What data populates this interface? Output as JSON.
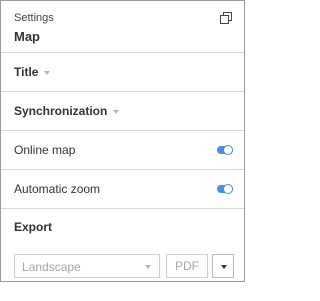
{
  "header": {
    "caption": "Settings",
    "title": "Map",
    "restore_icon": "restore-window-icon"
  },
  "sections": {
    "title_label": "Title",
    "sync_label": "Synchronization"
  },
  "toggles": {
    "online_map": {
      "label": "Online map",
      "on": true
    },
    "automatic_zoom": {
      "label": "Automatic zoom",
      "on": true
    }
  },
  "export": {
    "label": "Export",
    "orientation_value": "Landscape",
    "format_label": "PDF"
  },
  "colors": {
    "accent": "#4a8fd9",
    "border": "#9a9a9a",
    "divider": "#d7d7d7"
  }
}
